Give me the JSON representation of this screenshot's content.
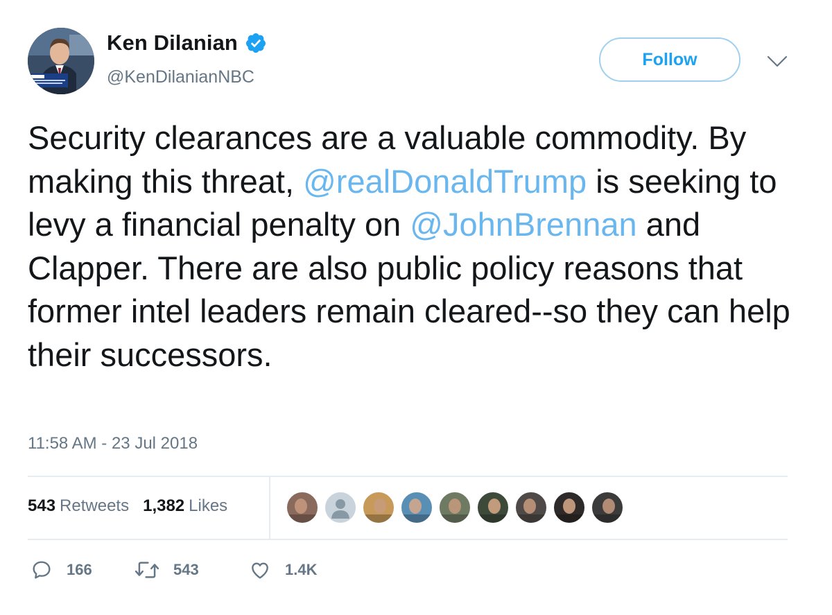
{
  "author": {
    "display_name": "Ken Dilanian",
    "handle": "@KenDilanianNBC",
    "verified": true,
    "avatar_icon": "profile-photo"
  },
  "header": {
    "follow_label": "Follow",
    "more_icon": "chevron-down-icon"
  },
  "tweet": {
    "text_segments": [
      {
        "type": "text",
        "value": "Security clearances are a valuable commodity.  By making this threat, "
      },
      {
        "type": "mention",
        "value": "@realDonaldTrump"
      },
      {
        "type": "text",
        "value": " is seeking to levy a financial penalty on "
      },
      {
        "type": "mention",
        "value": "@JohnBrennan"
      },
      {
        "type": "text",
        "value": " and Clapper.  There are also public policy reasons that former intel leaders remain cleared--so they can help their successors."
      }
    ],
    "timestamp": "11:58 AM - 23 Jul 2018"
  },
  "stats": {
    "retweets_count": "543",
    "retweets_label": "Retweets",
    "likes_count": "1,382",
    "likes_label": "Likes"
  },
  "likers": [
    {
      "name": "liker-1",
      "color": "#8a6a5c"
    },
    {
      "name": "liker-2",
      "color": "#c9d3db"
    },
    {
      "name": "liker-3",
      "color": "#c89a5a"
    },
    {
      "name": "liker-4",
      "color": "#5a8fb5"
    },
    {
      "name": "liker-5",
      "color": "#6f7a63"
    },
    {
      "name": "liker-6",
      "color": "#3d4a3a"
    },
    {
      "name": "liker-7",
      "color": "#4f4a47"
    },
    {
      "name": "liker-8",
      "color": "#2f2a2a"
    },
    {
      "name": "liker-9",
      "color": "#3b3b3b"
    }
  ],
  "actions": {
    "reply_count": "166",
    "retweet_count": "543",
    "like_count": "1.4K"
  },
  "colors": {
    "link": "#69b7ee",
    "secondary_text": "#657786",
    "primary_text": "#14171a",
    "follow_border": "#9fd0ef",
    "verified": "#1da1f2",
    "divider": "#e6ecf0"
  }
}
